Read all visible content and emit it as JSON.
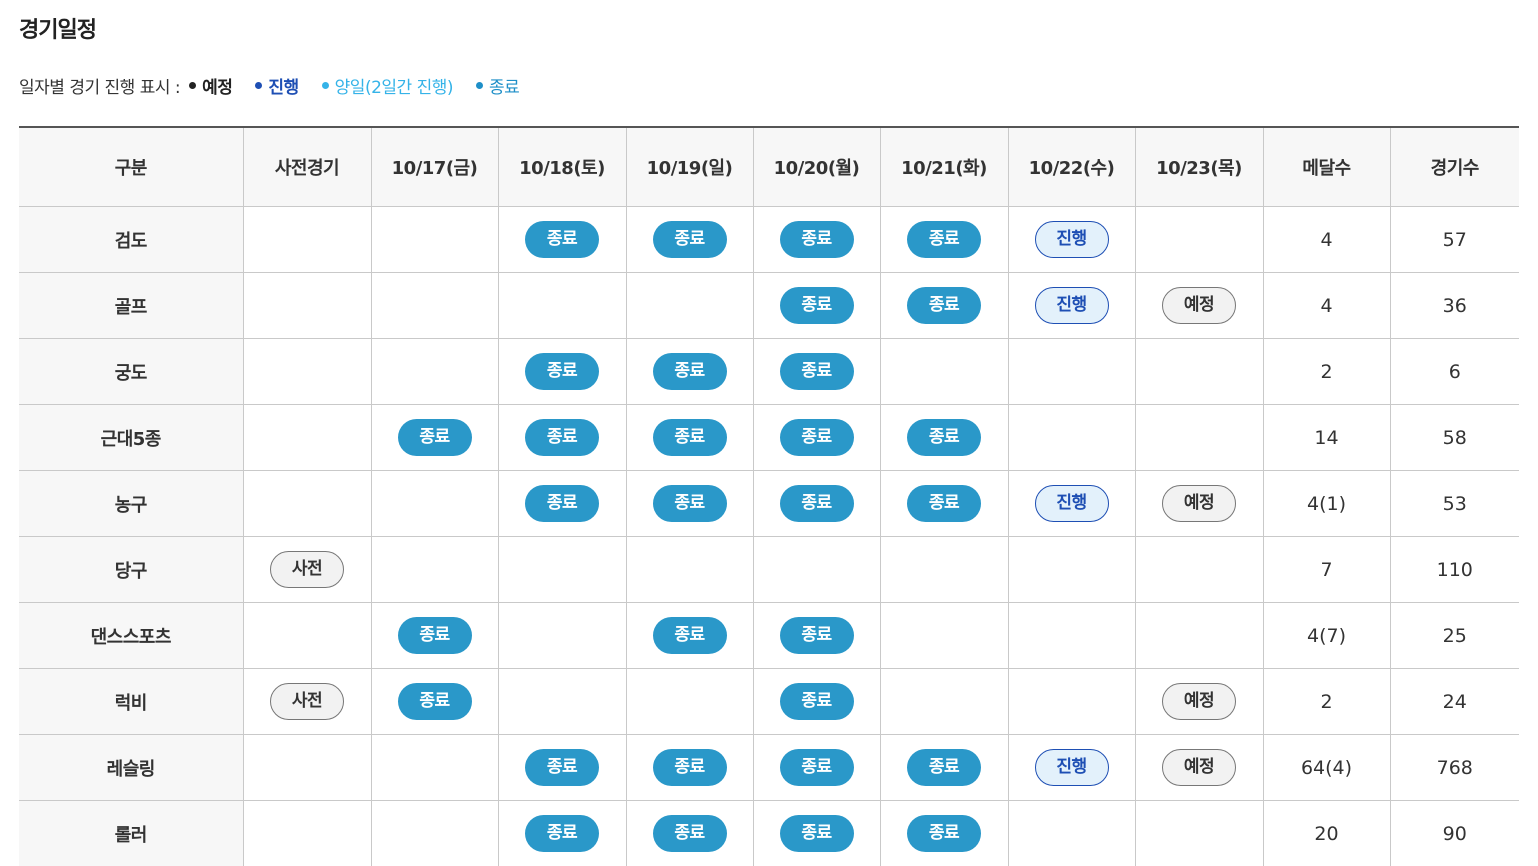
{
  "page": {
    "title": "경기일정"
  },
  "legend": {
    "label": "일자별 경기 진행 표시 :",
    "items": [
      {
        "key": "sched",
        "label": "예정",
        "color": "#222222"
      },
      {
        "key": "prog",
        "label": "진행",
        "color": "#1e4fb4"
      },
      {
        "key": "twoday",
        "label": "양일(2일간 진행)",
        "color": "#35b3e8"
      },
      {
        "key": "done",
        "label": "종료",
        "color": "#1e8fc8"
      }
    ]
  },
  "table": {
    "headers": [
      "구분",
      "사전경기",
      "10/17(금)",
      "10/18(토)",
      "10/19(일)",
      "10/20(월)",
      "10/21(화)",
      "10/22(수)",
      "10/23(목)",
      "메달수",
      "경기수"
    ],
    "status_labels": {
      "done": "종료",
      "prog": "진행",
      "sched": "예정",
      "pre": "사전"
    },
    "rows": [
      {
        "sport": "검도",
        "days": [
          "",
          "",
          "done",
          "done",
          "done",
          "done",
          "prog",
          ""
        ],
        "medals": "4",
        "matches": "57"
      },
      {
        "sport": "골프",
        "days": [
          "",
          "",
          "",
          "",
          "done",
          "done",
          "prog",
          "sched"
        ],
        "medals": "4",
        "matches": "36"
      },
      {
        "sport": "궁도",
        "days": [
          "",
          "",
          "done",
          "done",
          "done",
          "",
          "",
          ""
        ],
        "medals": "2",
        "matches": "6"
      },
      {
        "sport": "근대5종",
        "days": [
          "",
          "done",
          "done",
          "done",
          "done",
          "done",
          "",
          ""
        ],
        "medals": "14",
        "matches": "58"
      },
      {
        "sport": "농구",
        "days": [
          "",
          "",
          "done",
          "done",
          "done",
          "done",
          "prog",
          "sched"
        ],
        "medals": "4(1)",
        "matches": "53"
      },
      {
        "sport": "당구",
        "days": [
          "pre",
          "",
          "",
          "",
          "",
          "",
          "",
          ""
        ],
        "medals": "7",
        "matches": "110"
      },
      {
        "sport": "댄스스포츠",
        "days": [
          "",
          "done",
          "",
          "done",
          "done",
          "",
          "",
          ""
        ],
        "medals": "4(7)",
        "matches": "25"
      },
      {
        "sport": "럭비",
        "days": [
          "pre",
          "done",
          "",
          "",
          "done",
          "",
          "",
          "sched"
        ],
        "medals": "2",
        "matches": "24"
      },
      {
        "sport": "레슬링",
        "days": [
          "",
          "",
          "done",
          "done",
          "done",
          "done",
          "prog",
          "sched"
        ],
        "medals": "64(4)",
        "matches": "768"
      },
      {
        "sport": "롤러",
        "days": [
          "",
          "",
          "done",
          "done",
          "done",
          "done",
          "",
          ""
        ],
        "medals": "20",
        "matches": "90"
      }
    ]
  }
}
